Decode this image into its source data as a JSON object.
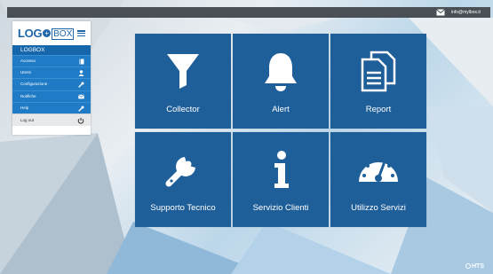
{
  "topbar": {
    "email": "info@mylbox.it",
    "mail_icon": "mail-icon"
  },
  "sidebar": {
    "logo": {
      "part1": "LOG",
      "plus": "+",
      "part2": "BOX"
    },
    "menu_title": "LOGBOX",
    "items": [
      {
        "label": "Accesso",
        "icon": "book-icon"
      },
      {
        "label": "Utenti",
        "icon": "user-icon"
      },
      {
        "label": "Configurazione",
        "icon": "wrench-icon"
      },
      {
        "label": "Notifiche",
        "icon": "envelope-icon"
      },
      {
        "label": "Help",
        "icon": "wrench-icon"
      }
    ],
    "logout": {
      "label": "Log out",
      "icon": "power-icon"
    }
  },
  "tiles": [
    {
      "label": "Collector",
      "icon": "funnel-icon"
    },
    {
      "label": "Alert",
      "icon": "bell-icon"
    },
    {
      "label": "Report",
      "icon": "documents-icon"
    },
    {
      "label": "Supporto Tecnico",
      "icon": "wrench-icon"
    },
    {
      "label": "Servizio Clienti",
      "icon": "info-icon"
    },
    {
      "label": "Utilizzo Servizi",
      "icon": "gauge-icon"
    }
  ],
  "footer": {
    "brand": "HTS"
  },
  "colors": {
    "tile": "#1f5f99",
    "menu": "#1f7bc6",
    "menu_title": "#1566ab",
    "topbar": "#4a4f55"
  }
}
